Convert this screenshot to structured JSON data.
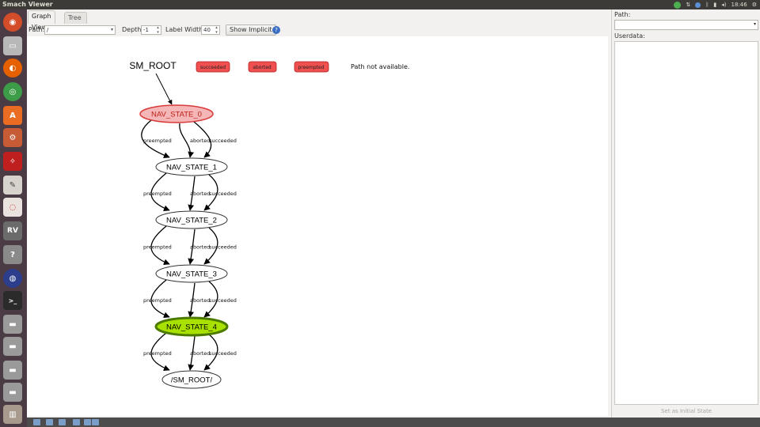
{
  "window_title": "Smach Viewer",
  "top_panel": {
    "clock": "18:46"
  },
  "tabs": [
    {
      "label": "Graph View",
      "active": true
    },
    {
      "label": "Tree View",
      "active": false
    }
  ],
  "toolbar": {
    "path_label": "Path:",
    "path_value": "/",
    "depth_label": "Depth:",
    "depth_value": "-1",
    "label_width_label": "Label Width:",
    "label_width_value": "40",
    "show_implicit_label": "Show Implicit",
    "help_symbol": "?"
  },
  "graph": {
    "root_label": "SM_ROOT",
    "outcome_badges": [
      "succeeded",
      "aborted",
      "preempted"
    ],
    "status_text": "Path not available.",
    "states": [
      {
        "label": "NAV_STATE_0",
        "status": "initial"
      },
      {
        "label": "NAV_STATE_1",
        "status": "normal"
      },
      {
        "label": "NAV_STATE_2",
        "status": "normal"
      },
      {
        "label": "NAV_STATE_3",
        "status": "normal"
      },
      {
        "label": "NAV_STATE_4",
        "status": "active"
      },
      {
        "label": "/SM_ROOT/",
        "status": "outcome"
      }
    ],
    "edge_labels": {
      "left": "preempted",
      "middle": "aborted",
      "right": "succeeded"
    }
  },
  "right_panel": {
    "path_label": "Path:",
    "userdata_label": "Userdata:",
    "set_initial_button": "Set as Initial State"
  },
  "colors": {
    "initial_fill": "#f4b6b6",
    "initial_stroke": "#d83a3a",
    "active_fill": "#a8e000",
    "active_stroke": "#4c7a00",
    "badge_fill": "#f05050",
    "launcher_bg": "#4a3b45"
  }
}
